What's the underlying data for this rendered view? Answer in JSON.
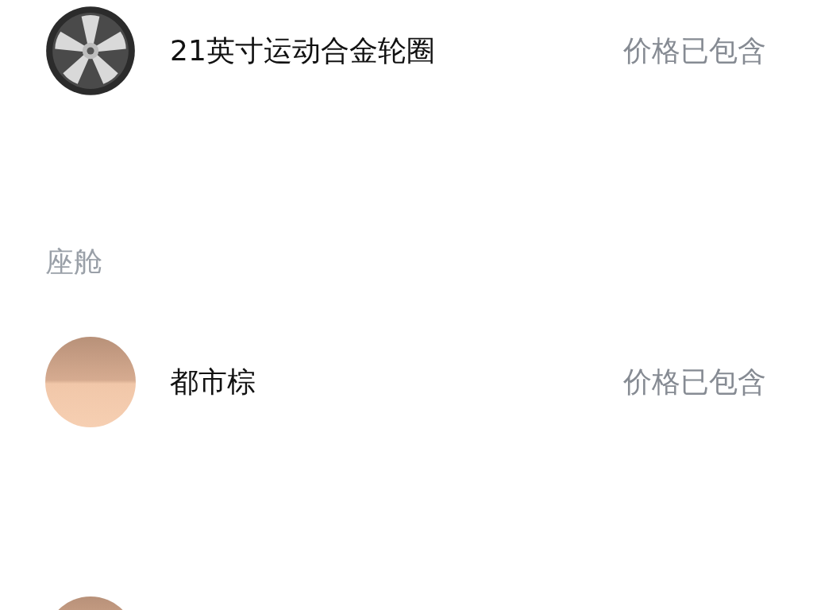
{
  "sections": [
    {
      "items": [
        {
          "kind": "wheel",
          "name": "21英寸运动合金轮圈",
          "price": "价格已包含"
        }
      ]
    },
    {
      "title": "座舱",
      "items": [
        {
          "kind": "swatch",
          "name": "都市棕",
          "price": "价格已包含"
        },
        {
          "kind": "swatch"
        }
      ]
    }
  ]
}
